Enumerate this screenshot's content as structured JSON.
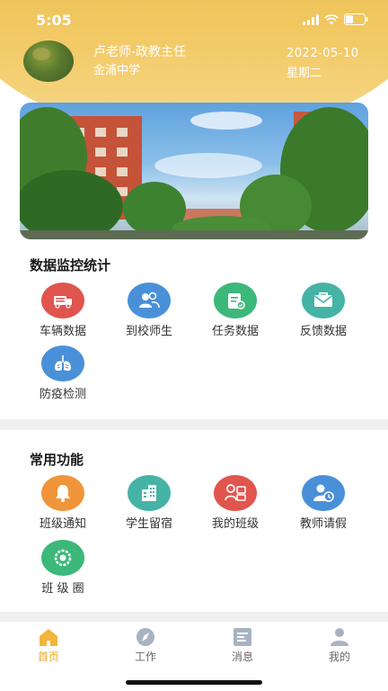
{
  "status_bar": {
    "time": "5:05"
  },
  "header": {
    "user_name": "卢老师-政教主任",
    "school": "金浦中学",
    "date": "2022-05-10",
    "weekday": "星期二"
  },
  "sections": {
    "monitor": {
      "title": "数据监控统计",
      "items": [
        {
          "label": "车辆数据",
          "icon": "car-icon",
          "color": "#e0554d"
        },
        {
          "label": "到校师生",
          "icon": "people-icon",
          "color": "#4a90d9"
        },
        {
          "label": "任务数据",
          "icon": "task-icon",
          "color": "#3cb87a"
        },
        {
          "label": "反馈数据",
          "icon": "feedback-mail-icon",
          "color": "#45b3a5"
        },
        {
          "label": "防疫检测",
          "icon": "lungs-icon",
          "color": "#4a90d9"
        }
      ]
    },
    "common": {
      "title": "常用功能",
      "items": [
        {
          "label": "班级通知",
          "icon": "bell-icon",
          "color": "#f0953a"
        },
        {
          "label": "学生留宿",
          "icon": "building-icon",
          "color": "#45b3a5"
        },
        {
          "label": "我的班级",
          "icon": "class-icon",
          "color": "#e0554d"
        },
        {
          "label": "教师请假",
          "icon": "teacher-leave-icon",
          "color": "#4a90d9"
        },
        {
          "label": "班 级 圈",
          "icon": "circle-icon",
          "color": "#3cb87a"
        }
      ]
    }
  },
  "tabbar": {
    "tabs": [
      {
        "label": "首页",
        "icon": "home-icon",
        "active": true
      },
      {
        "label": "工作",
        "icon": "compass-icon",
        "active": false
      },
      {
        "label": "消息",
        "icon": "message-icon",
        "active": false
      },
      {
        "label": "我的",
        "icon": "profile-icon",
        "active": false
      }
    ]
  },
  "colors": {
    "accent": "#e9a92a",
    "header": "#f1c760"
  }
}
